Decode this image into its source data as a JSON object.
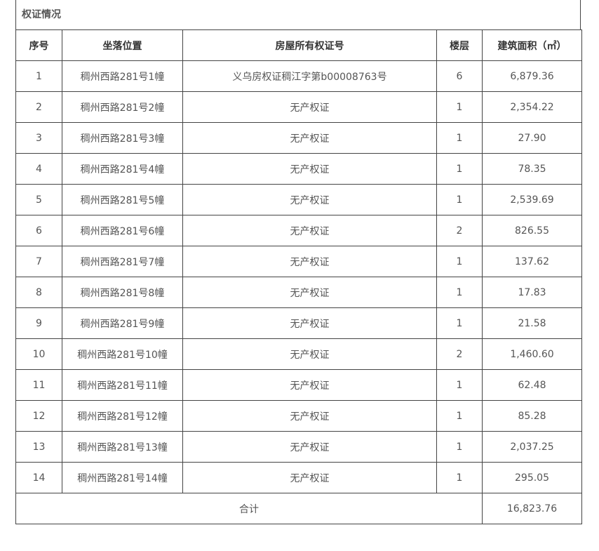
{
  "section_title": "权证情况",
  "headers": [
    "序号",
    "坐落位置",
    "房屋所有权证号",
    "楼层",
    "建筑面积（㎡）"
  ],
  "rows": [
    [
      "1",
      "稠州西路281号1幢",
      "义乌房权证稠江字第b00008763号",
      "6",
      "6,879.36"
    ],
    [
      "2",
      "稠州西路281号2幢",
      "无产权证",
      "1",
      "2,354.22"
    ],
    [
      "3",
      "稠州西路281号3幢",
      "无产权证",
      "1",
      "27.90"
    ],
    [
      "4",
      "稠州西路281号4幢",
      "无产权证",
      "1",
      "78.35"
    ],
    [
      "5",
      "稠州西路281号5幢",
      "无产权证",
      "1",
      "2,539.69"
    ],
    [
      "6",
      "稠州西路281号6幢",
      "无产权证",
      "2",
      "826.55"
    ],
    [
      "7",
      "稠州西路281号7幢",
      "无产权证",
      "1",
      "137.62"
    ],
    [
      "8",
      "稠州西路281号8幢",
      "无产权证",
      "1",
      "17.83"
    ],
    [
      "9",
      "稠州西路281号9幢",
      "无产权证",
      "1",
      "21.58"
    ],
    [
      "10",
      "稠州西路281号10幢",
      "无产权证",
      "2",
      "1,460.60"
    ],
    [
      "11",
      "稠州西路281号11幢",
      "无产权证",
      "1",
      "62.48"
    ],
    [
      "12",
      "稠州西路281号12幢",
      "无产权证",
      "1",
      "85.28"
    ],
    [
      "13",
      "稠州西路281号13幢",
      "无产权证",
      "1",
      "2,037.25"
    ],
    [
      "14",
      "稠州西路281号14幢",
      "无产权证",
      "1",
      "295.05"
    ]
  ],
  "total": {
    "label": "合计",
    "value": "16,823.76"
  }
}
